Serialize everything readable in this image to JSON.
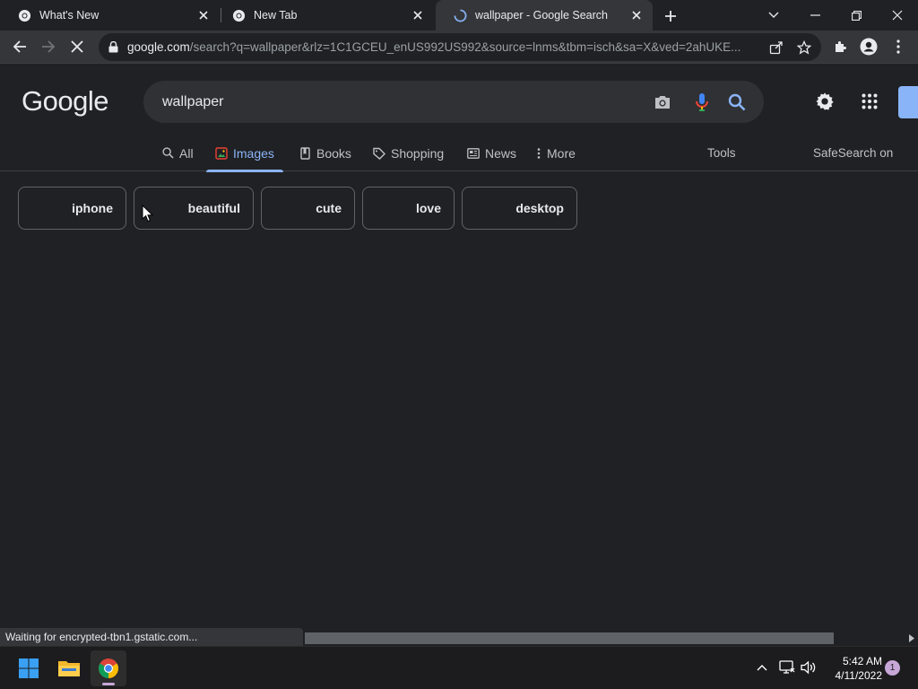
{
  "browser": {
    "tabs": [
      {
        "title": "What's New",
        "icon": "chrome-icon"
      },
      {
        "title": "New Tab",
        "icon": "chrome-icon"
      },
      {
        "title": "wallpaper - Google Search",
        "icon": "loading-spinner-icon",
        "active": true
      }
    ],
    "url_host": "google.com",
    "url_rest": "/search?q=wallpaper&rlz=1C1GCEU_enUS992US992&source=lnms&tbm=isch&sa=X&ved=2ahUKE..."
  },
  "google": {
    "logo": "Google",
    "query": "wallpaper",
    "nav_tabs": [
      {
        "label": "All",
        "icon": "search-icon"
      },
      {
        "label": "Images",
        "icon": "image-icon",
        "active": true
      },
      {
        "label": "Books",
        "icon": "book-icon"
      },
      {
        "label": "Shopping",
        "icon": "tag-icon"
      },
      {
        "label": "News",
        "icon": "news-icon"
      },
      {
        "label": "More",
        "icon": "more-vert-icon"
      }
    ],
    "tools_label": "Tools",
    "safesearch_label": "SafeSearch on",
    "chips": [
      "iphone",
      "beautiful",
      "cute",
      "love",
      "desktop"
    ]
  },
  "status": {
    "text": "Waiting for encrypted-tbn1.gstatic.com..."
  },
  "taskbar": {
    "time": "5:42 AM",
    "date": "4/11/2022",
    "notification_count": "1"
  },
  "colors": {
    "page_bg": "#202124",
    "accent": "#8ab4f8",
    "toolbar_bg": "#35363a"
  }
}
